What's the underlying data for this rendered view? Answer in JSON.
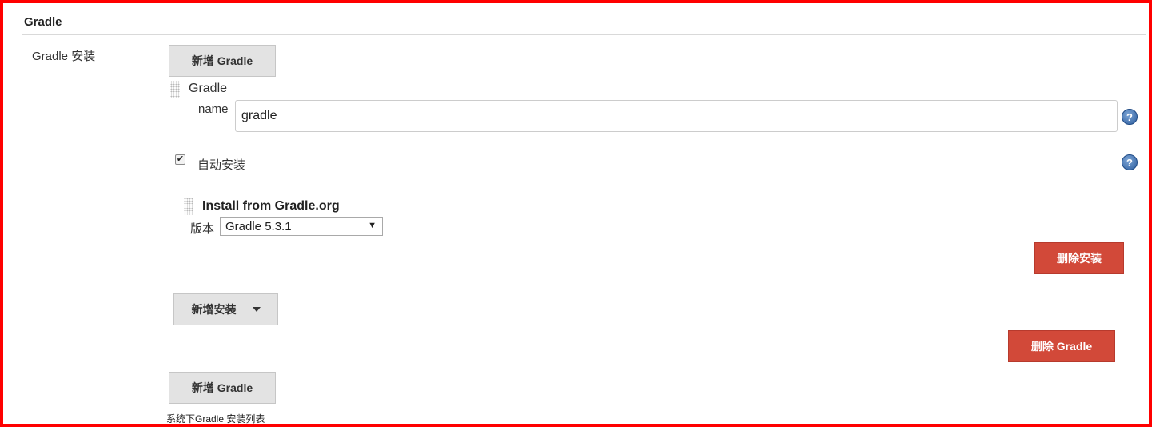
{
  "section": {
    "title": "Gradle"
  },
  "field_label": "Gradle 安装",
  "add_gradle_label": "新增 Gradle",
  "installation": {
    "title": "Gradle",
    "name_label": "name",
    "name_value": "gradle",
    "auto_install_label": "自动安装",
    "auto_install_checked": true,
    "installer": {
      "title": "Install from Gradle.org",
      "version_label": "版本",
      "version_value": "Gradle 5.3.1"
    },
    "delete_installer_label": "删除安装",
    "add_installer_label": "新增安装",
    "delete_gradle_label": "删除 Gradle"
  },
  "footer_note": "系统下Gradle 安装列表",
  "icons": {
    "help": "help-icon",
    "checkmark": "✔",
    "dropdown": "▼"
  },
  "colors": {
    "frame": "#ff0000",
    "danger_button": "#d24939",
    "grey_button": "#e3e3e3",
    "help_icon": "#2c5d9e"
  }
}
